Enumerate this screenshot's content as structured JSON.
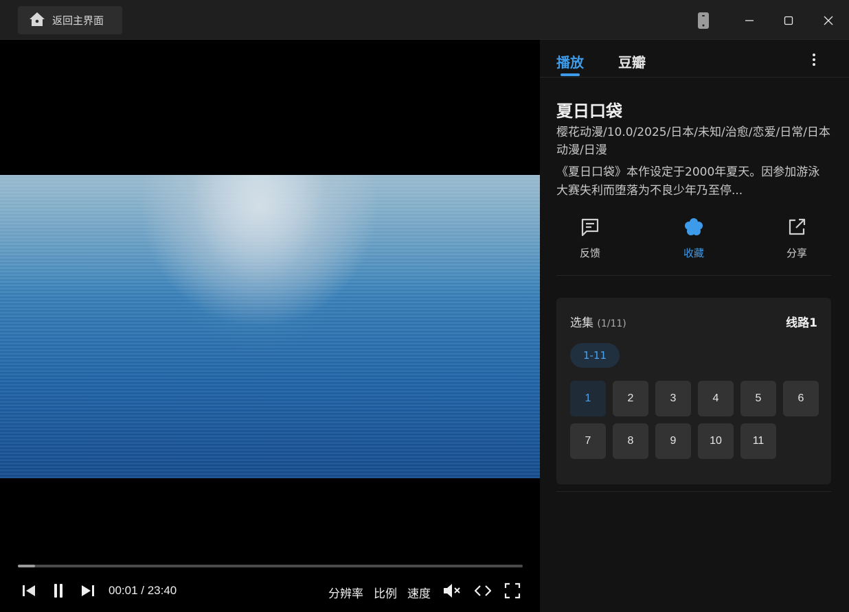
{
  "titlebar": {
    "home_label": "返回主界面",
    "icons": [
      "home-icon",
      "phone-icon",
      "minimize-icon",
      "maximize-icon",
      "close-icon"
    ]
  },
  "player": {
    "current_time": "00:01",
    "total_time": "23:40",
    "time_display": "00:01 / 23:40",
    "progress_fraction": 0.034,
    "resolution_label": "分辨率",
    "ratio_label": "比例",
    "speed_label": "速度",
    "muted": true
  },
  "panel": {
    "tabs": [
      {
        "label": "播放",
        "active": true
      },
      {
        "label": "豆瓣",
        "active": false
      }
    ],
    "title": "夏日口袋",
    "meta": "樱花动漫/10.0/2025/日本/未知/治愈/恋爱/日常/日本动漫/日漫",
    "description": "《夏日口袋》本作设定于2000年夏天。因参加游泳大赛失利而堕落为不良少年乃至停...",
    "actions": {
      "feedback": "反馈",
      "favorite": "收藏",
      "share": "分享"
    },
    "episodes": {
      "heading": "选集",
      "count": "(1/11)",
      "route": "线路1",
      "range": "1-11",
      "items": [
        "1",
        "2",
        "3",
        "4",
        "5",
        "6",
        "7",
        "8",
        "9",
        "10",
        "11"
      ],
      "active_index": 0
    }
  },
  "colors": {
    "accent": "#3d9be9",
    "panel_bg": "#131313",
    "card_bg": "#1f1f1f",
    "episode_bg": "#333333"
  }
}
